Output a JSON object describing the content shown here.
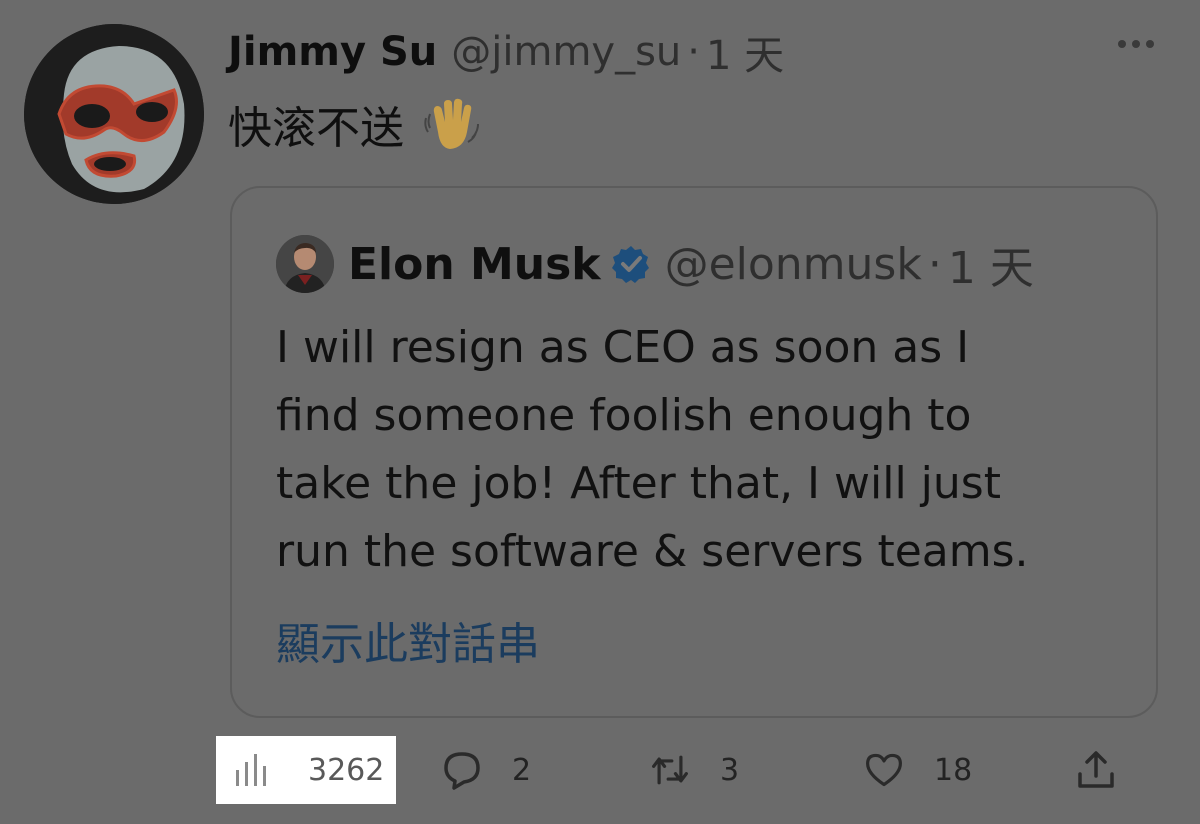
{
  "tweet": {
    "author_name": "Jimmy Su",
    "author_handle": "@jimmy_su",
    "separator": "·",
    "time": "1 天",
    "text": "快滚不送",
    "emoji_icon": "waving-hand-icon"
  },
  "quoted": {
    "author_name": "Elon Musk",
    "author_handle": "@elonmusk",
    "separator": "·",
    "time": "1 天",
    "lines": [
      "I will resign as CEO as soon as I",
      "find someone foolish enough to",
      "take the job! After that, I will just",
      "run the software & servers teams."
    ],
    "show_thread": "顯示此對話串",
    "verified_color": "#1d4e7c"
  },
  "actions": {
    "views": "3262",
    "replies": "2",
    "retweets": "3",
    "likes": "18"
  },
  "colors": {
    "background": "#6b6b6b",
    "highlight_box": "#ffffff",
    "link": "#1b3c5e"
  }
}
